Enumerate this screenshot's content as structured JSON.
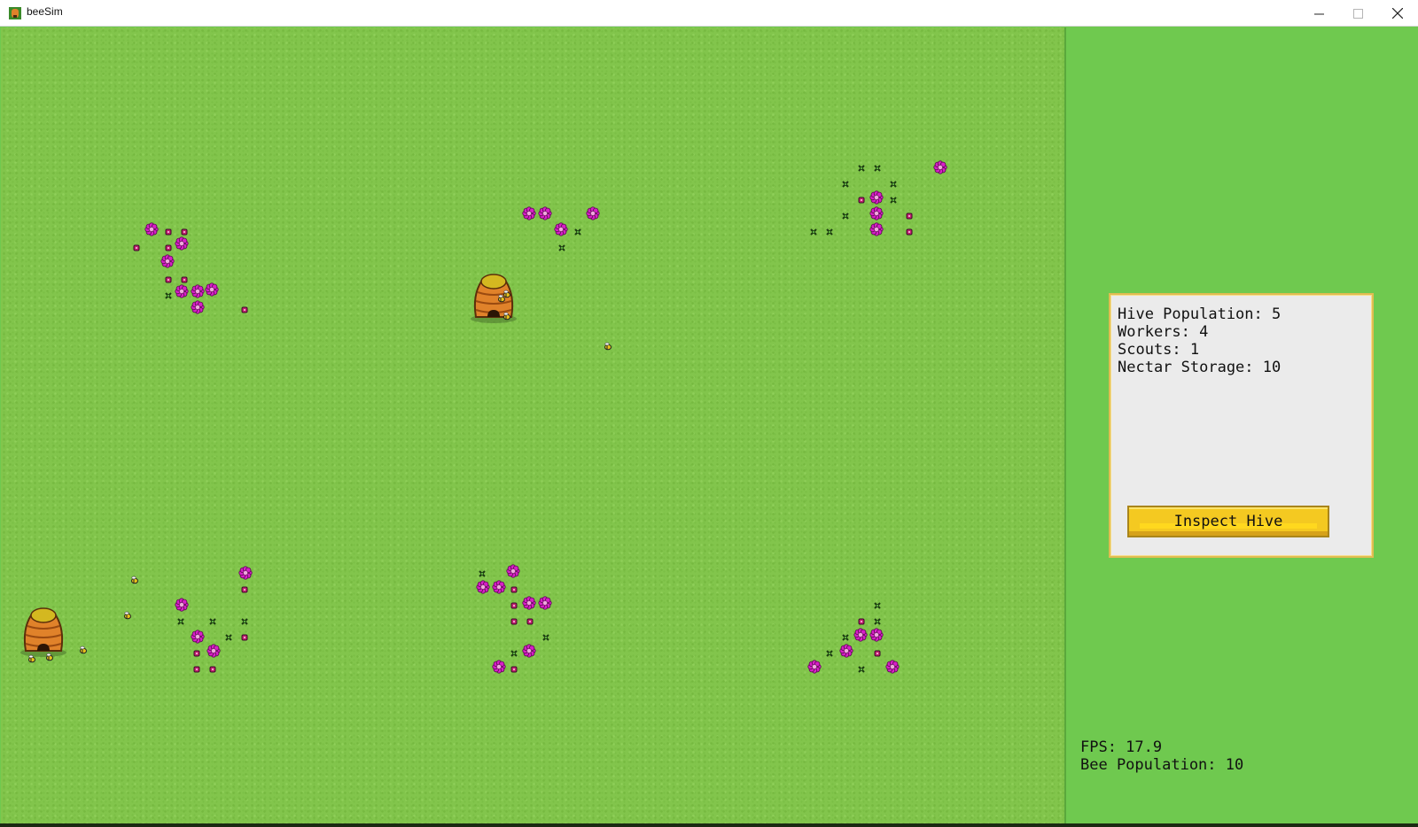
{
  "window": {
    "title": "beeSim"
  },
  "colors": {
    "grass": "#82c54c",
    "sidebar": "#6fc94f",
    "flower": "#d81ec8",
    "bud": "#c2206f",
    "hive": "#e0822a",
    "button": "#f4c921"
  },
  "hive_panel": {
    "population": "Hive Population: 5",
    "workers": "Workers: 4",
    "scouts": "Scouts: 1",
    "nectar": "Nectar Storage: 10",
    "button_label": "Inspect Hive"
  },
  "hud": {
    "fps": "FPS: 17.9",
    "bee_population": "Bee Population: 10"
  },
  "world": {
    "hives": 2,
    "bees_visible": 9,
    "flower_patches": 6
  }
}
